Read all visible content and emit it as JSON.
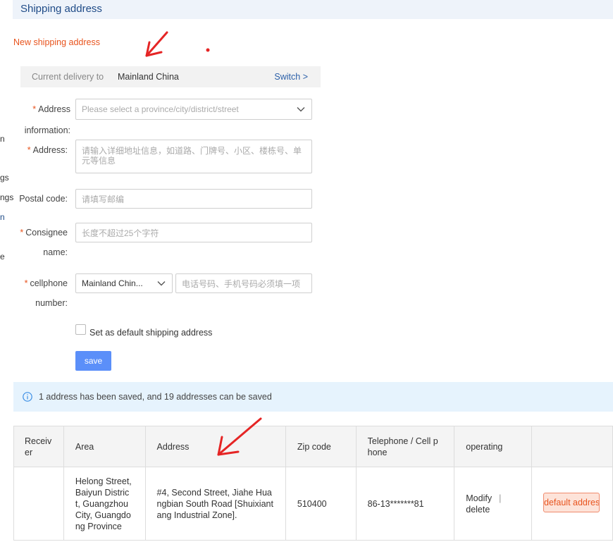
{
  "header": {
    "title": "Shipping address"
  },
  "form": {
    "new_title": "New shipping address",
    "delivery": {
      "label": "Current delivery to",
      "value": "Mainland China",
      "switch": "Switch >"
    },
    "address_info": {
      "label1": "Address",
      "label2": "information:",
      "placeholder": "Please select a province/city/district/street"
    },
    "address_detail": {
      "label": "Address:",
      "placeholder": "请输入详细地址信息，如道路、门牌号、小区、楼栋号、单元等信息"
    },
    "postal": {
      "label": "Postal code:",
      "placeholder": "请填写邮编"
    },
    "consignee": {
      "label1": "Consignee",
      "label2": "name:",
      "placeholder": "长度不超过25个字符"
    },
    "cellphone": {
      "label1": "cellphone",
      "label2": "number:",
      "region": "Mainland Chin...",
      "placeholder": "电话号码、手机号码必须填一项"
    },
    "default_checkbox": "Set as default shipping address",
    "save": "save"
  },
  "info": {
    "message": "1 address has been saved, and 19 addresses can be saved"
  },
  "table": {
    "headers": [
      "Receiver",
      "Area",
      "Address",
      "Zip code",
      "Telephone / Cell phone",
      "operating",
      ""
    ],
    "rows": [
      {
        "receiver": "",
        "area": "Helong Street, Baiyun District, Guangzhou City, Guangdong Province",
        "address": "#4, Second Street, Jiahe Huangbian South Road [Shuixiantang Industrial Zone].",
        "zip": "510400",
        "tel": "86-13*******81",
        "modify": "Modify",
        "separator": "|",
        "delete": "delete",
        "default": "default address"
      }
    ]
  },
  "side_fragments": [
    "n",
    "gs",
    "ngs",
    "n",
    "e"
  ],
  "colors": {
    "accent": "#e8541e",
    "link": "#2a5fa8",
    "button": "#5b8ff9",
    "header_bg": "#eef3fa",
    "info_bg": "#e6f3fd",
    "annotation": "#e52525"
  }
}
